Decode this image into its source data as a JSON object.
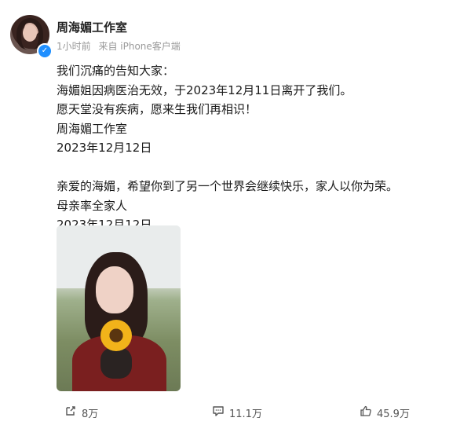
{
  "header": {
    "username": "周海媚工作室",
    "time": "1小时前",
    "source": "来自 iPhone客户端"
  },
  "post": {
    "lines": [
      "我们沉痛的告知大家：",
      "海媚姐因病医治无效，于2023年12月11日离开了我们。",
      "愿天堂没有疾病，愿来生我们再相识！",
      "周海媚工作室",
      "2023年12月12日",
      "亲爱的海媚，希望你到了另一个世界会继续快乐，家人以你为荣。",
      "母亲率全家人",
      "2023年12月12日"
    ]
  },
  "actions": {
    "share_count": "8万",
    "comment_count": "11.1万",
    "like_count": "45.9万"
  },
  "icons": {
    "share": "share-icon",
    "comment": "comment-icon",
    "like": "thumbs-up-icon",
    "verified": "verified-badge-icon"
  },
  "colors": {
    "verified": "#1f8fff",
    "meta_text": "#999999",
    "body_text": "#1a1a1a"
  }
}
